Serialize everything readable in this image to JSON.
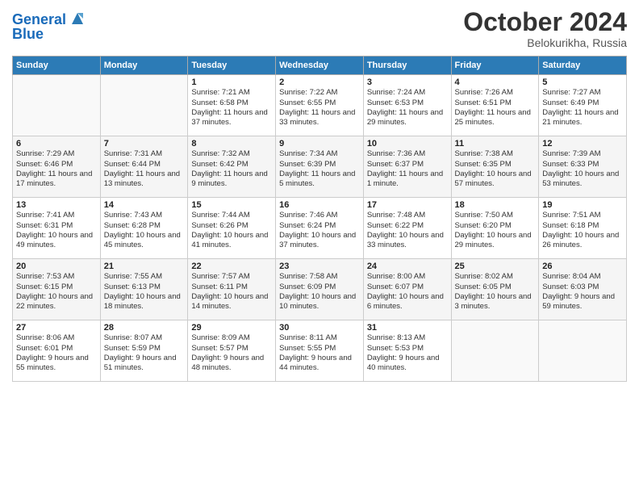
{
  "header": {
    "logo_line1": "General",
    "logo_line2": "Blue",
    "month": "October 2024",
    "location": "Belokurikha, Russia"
  },
  "days_of_week": [
    "Sunday",
    "Monday",
    "Tuesday",
    "Wednesday",
    "Thursday",
    "Friday",
    "Saturday"
  ],
  "weeks": [
    [
      {
        "day": "",
        "info": ""
      },
      {
        "day": "",
        "info": ""
      },
      {
        "day": "1",
        "info": "Sunrise: 7:21 AM\nSunset: 6:58 PM\nDaylight: 11 hours and 37 minutes."
      },
      {
        "day": "2",
        "info": "Sunrise: 7:22 AM\nSunset: 6:55 PM\nDaylight: 11 hours and 33 minutes."
      },
      {
        "day": "3",
        "info": "Sunrise: 7:24 AM\nSunset: 6:53 PM\nDaylight: 11 hours and 29 minutes."
      },
      {
        "day": "4",
        "info": "Sunrise: 7:26 AM\nSunset: 6:51 PM\nDaylight: 11 hours and 25 minutes."
      },
      {
        "day": "5",
        "info": "Sunrise: 7:27 AM\nSunset: 6:49 PM\nDaylight: 11 hours and 21 minutes."
      }
    ],
    [
      {
        "day": "6",
        "info": "Sunrise: 7:29 AM\nSunset: 6:46 PM\nDaylight: 11 hours and 17 minutes."
      },
      {
        "day": "7",
        "info": "Sunrise: 7:31 AM\nSunset: 6:44 PM\nDaylight: 11 hours and 13 minutes."
      },
      {
        "day": "8",
        "info": "Sunrise: 7:32 AM\nSunset: 6:42 PM\nDaylight: 11 hours and 9 minutes."
      },
      {
        "day": "9",
        "info": "Sunrise: 7:34 AM\nSunset: 6:39 PM\nDaylight: 11 hours and 5 minutes."
      },
      {
        "day": "10",
        "info": "Sunrise: 7:36 AM\nSunset: 6:37 PM\nDaylight: 11 hours and 1 minute."
      },
      {
        "day": "11",
        "info": "Sunrise: 7:38 AM\nSunset: 6:35 PM\nDaylight: 10 hours and 57 minutes."
      },
      {
        "day": "12",
        "info": "Sunrise: 7:39 AM\nSunset: 6:33 PM\nDaylight: 10 hours and 53 minutes."
      }
    ],
    [
      {
        "day": "13",
        "info": "Sunrise: 7:41 AM\nSunset: 6:31 PM\nDaylight: 10 hours and 49 minutes."
      },
      {
        "day": "14",
        "info": "Sunrise: 7:43 AM\nSunset: 6:28 PM\nDaylight: 10 hours and 45 minutes."
      },
      {
        "day": "15",
        "info": "Sunrise: 7:44 AM\nSunset: 6:26 PM\nDaylight: 10 hours and 41 minutes."
      },
      {
        "day": "16",
        "info": "Sunrise: 7:46 AM\nSunset: 6:24 PM\nDaylight: 10 hours and 37 minutes."
      },
      {
        "day": "17",
        "info": "Sunrise: 7:48 AM\nSunset: 6:22 PM\nDaylight: 10 hours and 33 minutes."
      },
      {
        "day": "18",
        "info": "Sunrise: 7:50 AM\nSunset: 6:20 PM\nDaylight: 10 hours and 29 minutes."
      },
      {
        "day": "19",
        "info": "Sunrise: 7:51 AM\nSunset: 6:18 PM\nDaylight: 10 hours and 26 minutes."
      }
    ],
    [
      {
        "day": "20",
        "info": "Sunrise: 7:53 AM\nSunset: 6:15 PM\nDaylight: 10 hours and 22 minutes."
      },
      {
        "day": "21",
        "info": "Sunrise: 7:55 AM\nSunset: 6:13 PM\nDaylight: 10 hours and 18 minutes."
      },
      {
        "day": "22",
        "info": "Sunrise: 7:57 AM\nSunset: 6:11 PM\nDaylight: 10 hours and 14 minutes."
      },
      {
        "day": "23",
        "info": "Sunrise: 7:58 AM\nSunset: 6:09 PM\nDaylight: 10 hours and 10 minutes."
      },
      {
        "day": "24",
        "info": "Sunrise: 8:00 AM\nSunset: 6:07 PM\nDaylight: 10 hours and 6 minutes."
      },
      {
        "day": "25",
        "info": "Sunrise: 8:02 AM\nSunset: 6:05 PM\nDaylight: 10 hours and 3 minutes."
      },
      {
        "day": "26",
        "info": "Sunrise: 8:04 AM\nSunset: 6:03 PM\nDaylight: 9 hours and 59 minutes."
      }
    ],
    [
      {
        "day": "27",
        "info": "Sunrise: 8:06 AM\nSunset: 6:01 PM\nDaylight: 9 hours and 55 minutes."
      },
      {
        "day": "28",
        "info": "Sunrise: 8:07 AM\nSunset: 5:59 PM\nDaylight: 9 hours and 51 minutes."
      },
      {
        "day": "29",
        "info": "Sunrise: 8:09 AM\nSunset: 5:57 PM\nDaylight: 9 hours and 48 minutes."
      },
      {
        "day": "30",
        "info": "Sunrise: 8:11 AM\nSunset: 5:55 PM\nDaylight: 9 hours and 44 minutes."
      },
      {
        "day": "31",
        "info": "Sunrise: 8:13 AM\nSunset: 5:53 PM\nDaylight: 9 hours and 40 minutes."
      },
      {
        "day": "",
        "info": ""
      },
      {
        "day": "",
        "info": ""
      }
    ]
  ]
}
